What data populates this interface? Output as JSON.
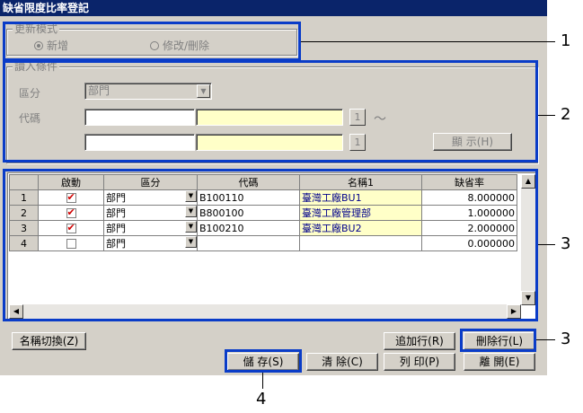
{
  "window": {
    "title": "缺省限度比率登記"
  },
  "update_mode": {
    "group_title": "更新模式",
    "options": [
      {
        "label": "新增",
        "selected": true
      },
      {
        "label": "修改/刪除",
        "selected": false
      }
    ]
  },
  "read_conditions": {
    "group_title": "讀入條件",
    "category_label": "區分",
    "category_value": "部門",
    "code_label": "代碼",
    "lookup_button_1": "1",
    "lookup_button_2": "1",
    "range_symbol": "～",
    "show_button": "顯 示(H)"
  },
  "grid": {
    "columns": [
      "",
      "啟動",
      "區分",
      "代碼",
      "名稱1",
      "缺省率"
    ],
    "rows": [
      {
        "index": "1",
        "active": true,
        "category": "部門",
        "code": "B100110",
        "name": "臺灣工廠BU1",
        "rate": "8.000000"
      },
      {
        "index": "2",
        "active": true,
        "category": "部門",
        "code": "B800100",
        "name": "臺灣工廠管理部",
        "rate": "1.000000"
      },
      {
        "index": "3",
        "active": true,
        "category": "部門",
        "code": "B100210",
        "name": "臺灣工廠BU2",
        "rate": "2.000000"
      },
      {
        "index": "4",
        "active": false,
        "category": "部門",
        "code": "",
        "name": "",
        "rate": "0.000000"
      }
    ]
  },
  "buttons": {
    "name_switch": "名稱切換(Z)",
    "add_row": "追加行(R)",
    "delete_row": "刪除行(L)",
    "save": "儲 存(S)",
    "clear": "清 除(C)",
    "print": "列 印(P)",
    "close": "離 開(E)"
  },
  "callouts": {
    "c1": "1",
    "c2": "2",
    "c3a": "3",
    "c3b": "3",
    "c4": "4"
  },
  "colors": {
    "title_bar": "#0a246a",
    "callout_border": "#0a3cc8",
    "check": "#d00000"
  }
}
